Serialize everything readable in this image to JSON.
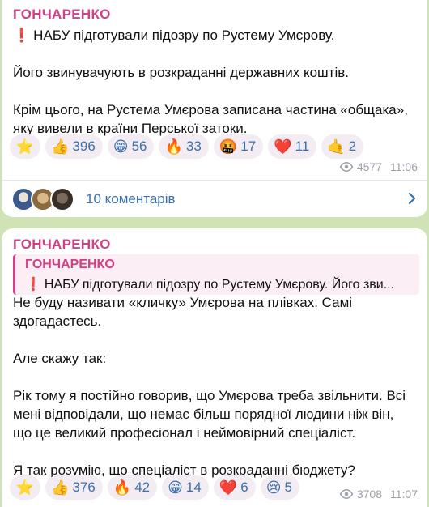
{
  "colors": {
    "background": "#cfe3b6",
    "sender": "#d13f84",
    "reaction_text": "#3a6fae",
    "meta": "#9aa1a9"
  },
  "messages": [
    {
      "sender": "ГОНЧАРЕНКО",
      "lead_mark": "❗",
      "paragraphs": [
        "НАБУ підготували підозру по Рустему Умєрову.",
        "Його звинувачують в розкраданні державних коштів.",
        "Крім цього, на Рустема Умєрова записана частина «общака», яку вивели в країни Перської затоки."
      ],
      "reactions": [
        {
          "emoji": "⭐",
          "count": ""
        },
        {
          "emoji": "👍",
          "count": "396"
        },
        {
          "emoji": "😁",
          "count": "56"
        },
        {
          "emoji": "🔥",
          "count": "33"
        },
        {
          "emoji": "🤬",
          "count": "17"
        },
        {
          "emoji": "❤️",
          "count": "11"
        },
        {
          "emoji": "🤙",
          "count": "2"
        }
      ],
      "views": "4577",
      "time": "11:06",
      "comments_label": "10 коментарів"
    },
    {
      "sender": "ГОНЧАРЕНКО",
      "quote": {
        "sender": "ГОНЧАРЕНКО",
        "mark": "❗",
        "text": "НАБУ підготували підозру по Рустему Умєрову.   Його зви..."
      },
      "paragraphs": [
        "Не буду називати «кличку» Умєрова на плівках. Самі здогадаєтесь.",
        "Але скажу так:",
        "Рік тому я постійно говорив, що Умєрова треба звільнити. Всі мені відповідали, що немає більш порядної людини ніж він, що це великий професіонал і неймовірний спеціаліст.",
        "Я так розумію, що спеціаліст в розкраданні бюджету?"
      ],
      "reactions": [
        {
          "emoji": "⭐",
          "count": ""
        },
        {
          "emoji": "👍",
          "count": "376"
        },
        {
          "emoji": "🔥",
          "count": "42"
        },
        {
          "emoji": "😁",
          "count": "14"
        },
        {
          "emoji": "❤️",
          "count": "6"
        },
        {
          "emoji": "😢",
          "count": "5"
        }
      ],
      "views": "3708",
      "time": "11:07"
    }
  ],
  "icons": {
    "views": "eye-icon",
    "comments_arrow": "chevron-right-icon"
  }
}
